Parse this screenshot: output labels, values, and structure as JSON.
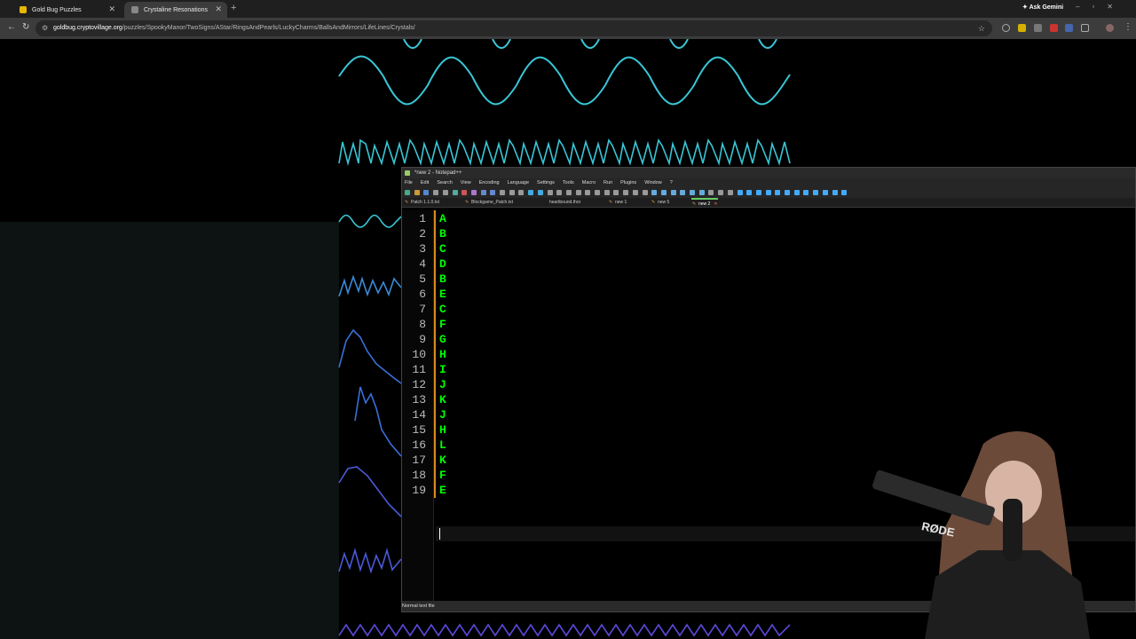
{
  "browser": {
    "tabs": [
      {
        "title": "Gold Bug Puzzles",
        "active": false
      },
      {
        "title": "Crystaline Resonations",
        "active": true
      }
    ],
    "ask_gemini": "Ask Gemini",
    "url_host": "goldbug.cryptovillage.org",
    "url_path": "/puzzles/SpookyManor/TwoSigns/AStar/RingsAndPearls/LuckyCharms/BallsAndMirrors/LifeLines/Crystals/"
  },
  "notepad": {
    "title": "*new 2 - Notepad++",
    "menu": [
      "File",
      "Edit",
      "Search",
      "View",
      "Encoding",
      "Language",
      "Settings",
      "Tools",
      "Macro",
      "Run",
      "Plugins",
      "Window",
      "?"
    ],
    "tabs": [
      {
        "label": "Patch 1.1.0.txt",
        "active": false
      },
      {
        "label": "Blockgame_Patch.txt",
        "active": false
      },
      {
        "label": "heartbound.thor",
        "active": false
      },
      {
        "label": "new 1",
        "active": false
      },
      {
        "label": "new 5",
        "active": false
      },
      {
        "label": "new 2",
        "active": true
      }
    ],
    "line_numbers": [
      "1",
      "2",
      "3",
      "4",
      "5",
      "6",
      "7",
      "8",
      "9",
      "10",
      "11",
      "12",
      "13",
      "14",
      "15",
      "16",
      "17",
      "18",
      "19"
    ],
    "lines": [
      "A",
      "B",
      "C",
      "D",
      "B",
      "E",
      "C",
      "F",
      "G",
      "H",
      "I",
      "J",
      "K",
      "J",
      "H",
      "L",
      "K",
      "F",
      "E"
    ],
    "status": "Normal text file"
  },
  "webcam": {
    "mic_brand": "RØDE"
  },
  "colors": {
    "wave_cyan": "#39c6d6",
    "wave_blue": "#3a6fd8",
    "wave_purple": "#5a48d8",
    "code_text": "#00ff00",
    "change_bar": "#d98a1a"
  }
}
